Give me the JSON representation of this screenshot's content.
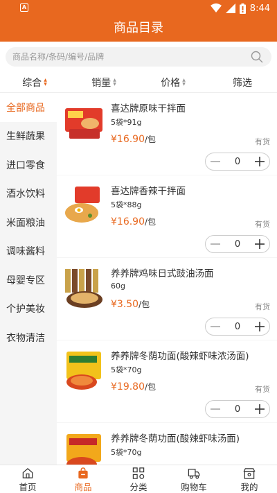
{
  "status_bar": {
    "notif_glyph": "A",
    "time": "8:44",
    "icons": [
      "wifi-icon",
      "signal-icon",
      "battery-icon"
    ]
  },
  "header": {
    "title": "商品目录"
  },
  "search": {
    "placeholder": "商品名称/条码/编号/品牌",
    "value": ""
  },
  "sort": {
    "items": [
      {
        "label": "综合",
        "active": true
      },
      {
        "label": "销量"
      },
      {
        "label": "价格"
      },
      {
        "label": "筛选"
      }
    ]
  },
  "sidebar": {
    "items": [
      {
        "label": "全部商品",
        "active": true
      },
      {
        "label": "生鲜蔬果"
      },
      {
        "label": "进口零食"
      },
      {
        "label": "酒水饮料"
      },
      {
        "label": "米面粮油"
      },
      {
        "label": "调味酱料"
      },
      {
        "label": "母婴专区"
      },
      {
        "label": "个护美妆"
      },
      {
        "label": "衣物清洁"
      }
    ]
  },
  "products": [
    {
      "name": "喜达牌原味干拌面",
      "spec": "5袋*91g",
      "price": "¥16.90",
      "unit": "/包",
      "stock": "有货",
      "qty": "0"
    },
    {
      "name": "喜达牌香辣干拌面",
      "spec": "5袋*88g",
      "price": "¥16.90",
      "unit": "/包",
      "stock": "有货",
      "qty": "0"
    },
    {
      "name": "养养牌鸡味日式豉油汤面",
      "spec": "60g",
      "price": "¥3.50",
      "unit": "/包",
      "stock": "有货",
      "qty": "0"
    },
    {
      "name": "养养牌冬荫功面(酸辣虾味浓汤面)",
      "spec": "5袋*70g",
      "price": "¥19.80",
      "unit": "/包",
      "stock": "有货",
      "qty": "0"
    },
    {
      "name": "养养牌冬荫功面(酸辣虾味汤面)",
      "spec": "5袋*70g",
      "price": "",
      "unit": "",
      "stock": "",
      "qty": ""
    }
  ],
  "bottom_nav": {
    "items": [
      {
        "label": "首页",
        "icon": "home-icon"
      },
      {
        "label": "商品",
        "icon": "bag-icon",
        "active": true
      },
      {
        "label": "分类",
        "icon": "category-icon"
      },
      {
        "label": "购物车",
        "icon": "truck-icon"
      },
      {
        "label": "我的",
        "icon": "store-icon"
      }
    ]
  },
  "colors": {
    "accent": "#e8681f",
    "sidebar_bg": "#f5f5f5",
    "text": "#333333"
  }
}
